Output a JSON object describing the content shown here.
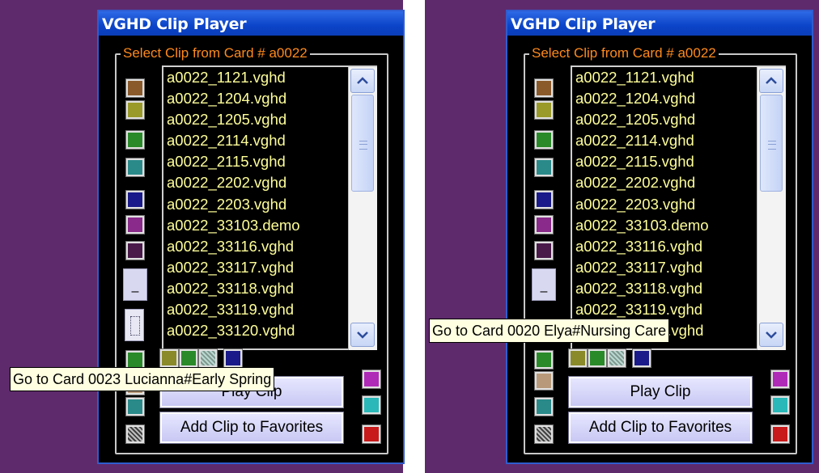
{
  "left": {
    "title": "VGHD Clip Player",
    "group_label": "Select Clip from Card # a0022",
    "clips": [
      "a0022_1121.vghd",
      "a0022_1204.vghd",
      "a0022_1205.vghd",
      "a0022_2114.vghd",
      "a0022_2115.vghd",
      "a0022_2202.vghd",
      "a0022_2203.vghd",
      "a0022_33103.demo",
      "a0022_33116.vghd",
      "a0022_33117.vghd",
      "a0022_33118.vghd",
      "a0022_33119.vghd",
      "a0022_33120.vghd"
    ],
    "play_label": "Play Clip",
    "fav_label": "Add Clip to Favorites",
    "tooltip": "Go to Card 0023 Lucianna#Early Spring",
    "scroll_up_icon": "chevron-up-icon",
    "scroll_down_icon": "chevron-down-icon",
    "minus_label": "–"
  },
  "right": {
    "title": "VGHD Clip Player",
    "group_label": "Select Clip from Card # a0022",
    "clips": [
      "a0022_1121.vghd",
      "a0022_1204.vghd",
      "a0022_1205.vghd",
      "a0022_2114.vghd",
      "a0022_2115.vghd",
      "a0022_2202.vghd",
      "a0022_2203.vghd",
      "a0022_33103.demo",
      "a0022_33116.vghd",
      "a0022_33117.vghd",
      "a0022_33118.vghd",
      "a0022_33119.vghd",
      "a0022_33120.vghd"
    ],
    "play_label": "Play Clip",
    "fav_label": "Add Clip to Favorites",
    "tooltip": "Go to Card 0020 Elya#Nursing Care",
    "minus_label": "–"
  },
  "colors": {
    "background_purple": "#5e2a6c",
    "title_blue": "#0b44c8",
    "group_label_orange": "#ff8a1c",
    "list_text_yellow": "#ffff99",
    "swatches_left_column": [
      "#8b5a2b",
      "#9a9a2a",
      "#2a8a2a",
      "#2a8a8a",
      "#1a1a8a",
      "#8a2a8a",
      "#4a1a4a"
    ],
    "swatches_bottom_row": [
      "#8a8a2a",
      "#2a8a2a",
      "#b8d8d0",
      "#1a1a8a"
    ],
    "swatches_right_column": [
      "#b02ab8",
      "#2ab8b8",
      "#c81a1a"
    ],
    "swatches_lower_left": [
      "#2a8a2a",
      "#b89a7a",
      "#2a8a8a",
      "#a0a0a0"
    ]
  }
}
